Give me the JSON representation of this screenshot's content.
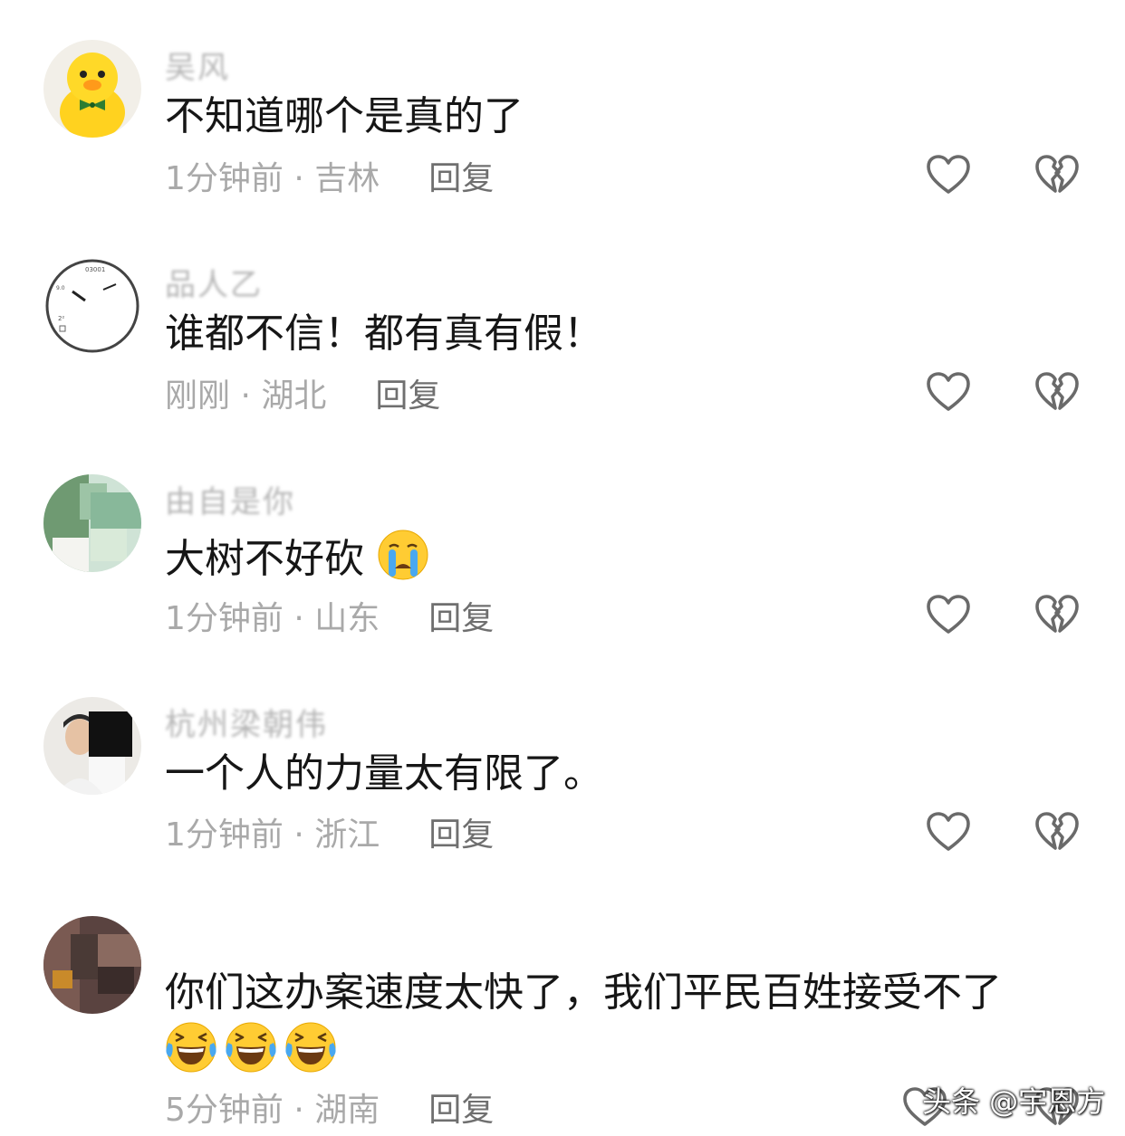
{
  "comments": [
    {
      "username": "吴风",
      "text": "不知道哪个是真的了",
      "time_location": "1分钟前 · 吉林",
      "reply_label": "回复",
      "avatar": "yellow-duck-plush"
    },
    {
      "username": "品人乙",
      "text": "谁都不信！都有真有假！",
      "time_location": "刚刚 · 湖北",
      "reply_label": "回复",
      "avatar": "clock-face"
    },
    {
      "username": "由自是你",
      "text": "大树不好砍",
      "emoji": "crying-face",
      "time_location": "1分钟前 · 山东",
      "reply_label": "回复",
      "avatar": "green-portrait"
    },
    {
      "username": "杭州梁朝伟",
      "text": "一个人的力量太有限了。",
      "time_location": "1分钟前 · 浙江",
      "reply_label": "回复",
      "avatar": "person-portrait"
    },
    {
      "username": "",
      "text": "你们这办案速度太快了，我们平民百姓接受不了",
      "emojis": [
        "rolling-laughing-face",
        "rolling-laughing-face",
        "rolling-laughing-face"
      ],
      "time_location": "5分钟前 · 湖南",
      "reply_label": "回复",
      "avatar": "dark-pixel-portrait"
    }
  ],
  "icons": {
    "like": "heart-outline-icon",
    "dislike": "broken-heart-icon"
  },
  "colors": {
    "text_primary": "#161616",
    "text_meta": "#a9a9a9",
    "text_reply": "#6f6f6f",
    "icon_stroke": "#6a6a6a"
  },
  "watermark": "头条 @宇恩方"
}
